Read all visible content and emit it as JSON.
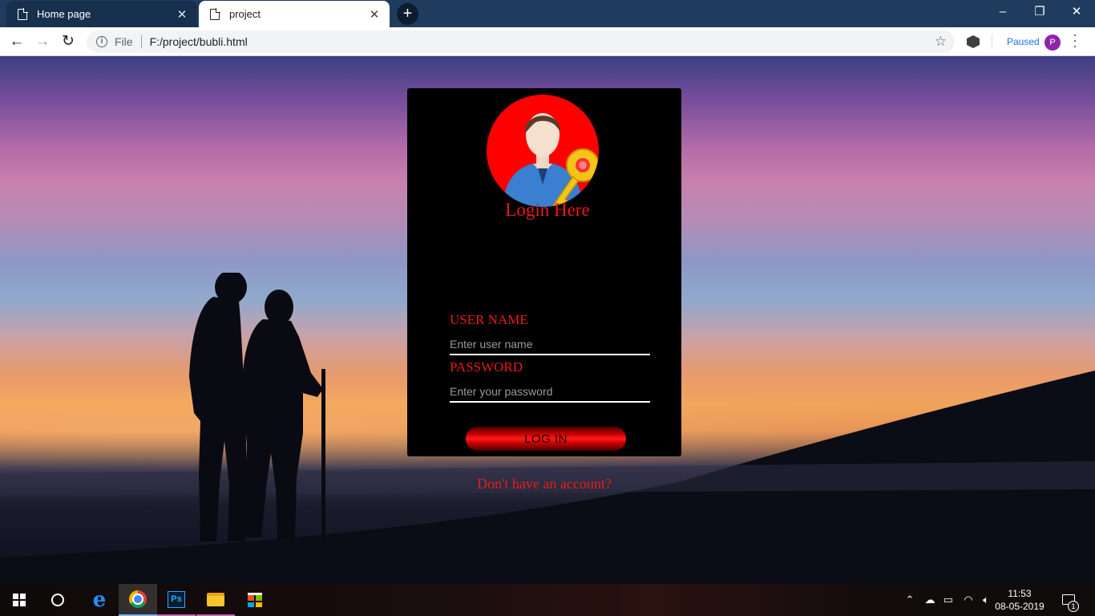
{
  "browser": {
    "tabs": [
      {
        "label": "Home page",
        "active": false
      },
      {
        "label": "project",
        "active": true
      }
    ],
    "address": {
      "scheme": "File",
      "url": "F:/project/bubli.html"
    },
    "profile": {
      "status": "Paused",
      "initial": "P"
    }
  },
  "login": {
    "title": "Login Here",
    "username_label": "USER NAME",
    "username_placeholder": "Enter user name",
    "password_label": "PASSWORD",
    "password_placeholder": "Enter your password",
    "button_label": "LOG IN",
    "signup_link": "Don't have an account?"
  },
  "taskbar": {
    "apps": [
      "start-icon",
      "cortana-icon",
      "edge-icon",
      "chrome-icon",
      "photoshop-icon",
      "file-explorer-icon",
      "store-icon"
    ],
    "ps_label": "Ps",
    "time": "11:53",
    "date": "08-05-2019",
    "notification_count": "1"
  },
  "colors": {
    "accent_red": "#e81b1b",
    "card_bg": "#000000",
    "tabbar_bg": "#1f3c5e"
  }
}
